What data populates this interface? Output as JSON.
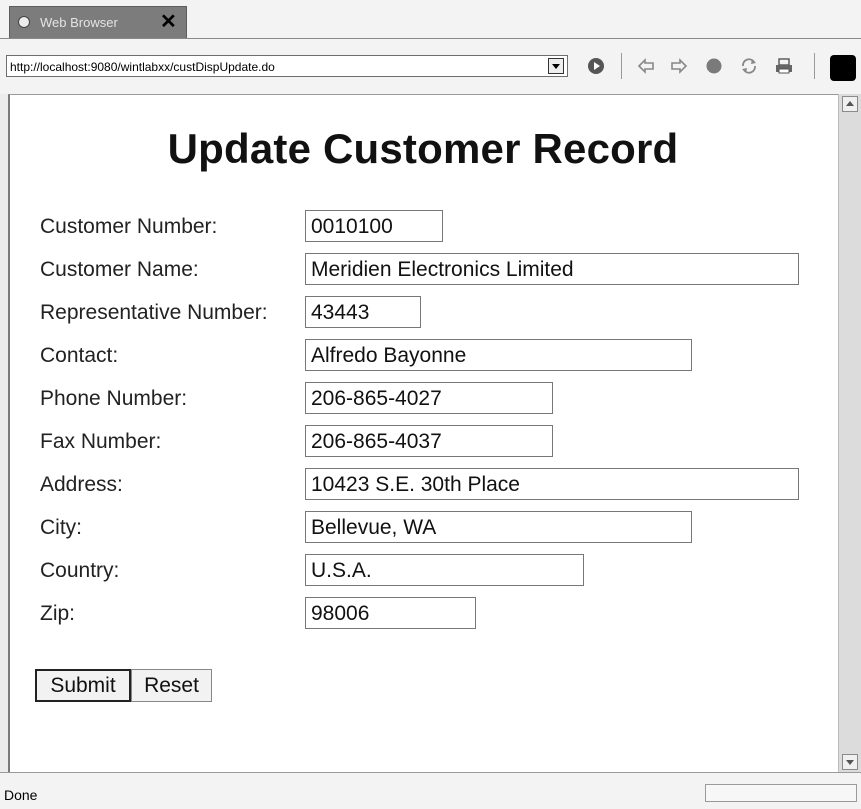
{
  "tab": {
    "title": "Web Browser",
    "close": "✕"
  },
  "toolbar": {
    "url": "http://localhost:9080/wintlabxx/custDispUpdate.do"
  },
  "page": {
    "title": "Update Customer Record",
    "fields": [
      {
        "label": "Customer Number:",
        "value": "0010100"
      },
      {
        "label": "Customer Name:",
        "value": "Meridien Electronics Limited"
      },
      {
        "label": "Representative Number:",
        "value": "43443"
      },
      {
        "label": "Contact:",
        "value": "Alfredo Bayonne"
      },
      {
        "label": "Phone Number:",
        "value": "206-865-4027"
      },
      {
        "label": "Fax Number:",
        "value": "206-865-4037"
      },
      {
        "label": "Address:",
        "value": "10423 S.E. 30th Place"
      },
      {
        "label": "City:",
        "value": "Bellevue, WA"
      },
      {
        "label": "Country:",
        "value": "U.S.A."
      },
      {
        "label": "Zip:",
        "value": "98006"
      }
    ],
    "submit_label": "Submit",
    "reset_label": "Reset"
  },
  "status": {
    "text": "Done"
  },
  "icons": {
    "tab": "globe-icon",
    "toolbar": [
      "go-icon",
      "back-icon",
      "forward-icon",
      "stop-icon",
      "refresh-icon",
      "print-icon"
    ]
  }
}
